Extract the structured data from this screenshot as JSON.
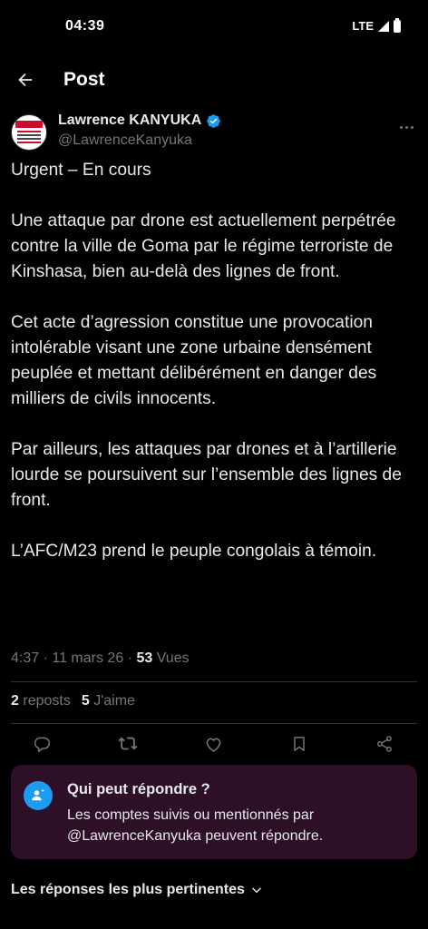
{
  "status_bar": {
    "time": "04:39",
    "network": "LTE"
  },
  "header": {
    "title": "Post"
  },
  "author": {
    "name": "Lawrence KANYUKA",
    "handle": "@LawrenceKanyuka",
    "verified_color": "#1d9bf0"
  },
  "tweet": {
    "paragraphs": [
      "Urgent – En cours",
      "Une attaque par drone est actuellement perpétrée contre la ville de Goma par le régime terroriste de Kinshasa, bien au-delà des lignes de front.",
      "Cet acte d’agression constitue une provocation intolérable visant une zone urbaine densément peuplée et mettant délibérément en danger des milliers de civils innocents.",
      "Par ailleurs, les attaques par drones et à l’artillerie lourde se poursuivent sur l’ensemble des lignes de front.",
      "L’AFC/M23 prend le peuple congolais à témoin."
    ],
    "time": "4:37",
    "date": "11 mars 26",
    "views_count": "53",
    "views_label": "Vues"
  },
  "stats": {
    "reposts_count": "2",
    "reposts_label": "reposts",
    "likes_count": "5",
    "likes_label": "J'aime"
  },
  "actions": [
    "reply-icon",
    "repost-icon",
    "like-icon",
    "bookmark-icon",
    "share-icon"
  ],
  "reply_settings": {
    "title": "Qui peut répondre ?",
    "description": "Les comptes suivis ou mentionnés par @LawrenceKanyuka peuvent répondre.",
    "background": "#2d0f27"
  },
  "replies_sort": {
    "label": "Les réponses les plus pertinentes"
  }
}
